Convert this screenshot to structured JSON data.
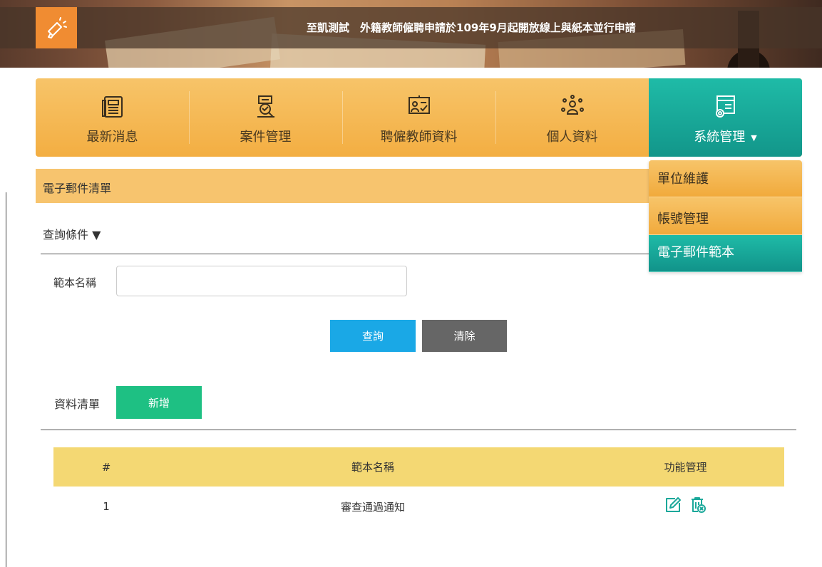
{
  "banner": {
    "notice": "至凱測試　外籍教師僱聘申請於109年9月起開放線上與紙本並行申請",
    "icon": "megaphone-icon"
  },
  "nav": {
    "items": [
      {
        "label": "最新消息",
        "icon": "newspaper-icon"
      },
      {
        "label": "案件管理",
        "icon": "case-search-icon"
      },
      {
        "label": "聘僱教師資料",
        "icon": "teacher-board-icon"
      },
      {
        "label": "個人資料",
        "icon": "person-network-icon"
      },
      {
        "label": "系統管理",
        "icon": "system-settings-icon",
        "active": true
      }
    ],
    "dropdown": [
      {
        "label": "單位維護"
      },
      {
        "label": "帳號管理"
      },
      {
        "label": "電子郵件範本",
        "active": true
      }
    ]
  },
  "section": {
    "title": "電子郵件清單",
    "query_toggle": "查詢條件 ▼"
  },
  "form": {
    "template_name_label": "範本名稱",
    "template_name_value": "",
    "search_label": "查詢",
    "clear_label": "清除"
  },
  "list": {
    "label": "資料清單",
    "add_label": "新增"
  },
  "table": {
    "headers": [
      "#",
      "範本名稱",
      "功能管理"
    ],
    "rows": [
      {
        "num": "1",
        "name": "審查通過通知"
      }
    ]
  },
  "colors": {
    "nav_bg": "#f3ae42",
    "nav_active": "#12968a",
    "section_bg": "#f7c46e",
    "table_head": "#f4d873",
    "btn_search": "#1aa8e6",
    "btn_clear": "#666666",
    "btn_add": "#1ec083",
    "action_icon": "#1aa89a"
  }
}
